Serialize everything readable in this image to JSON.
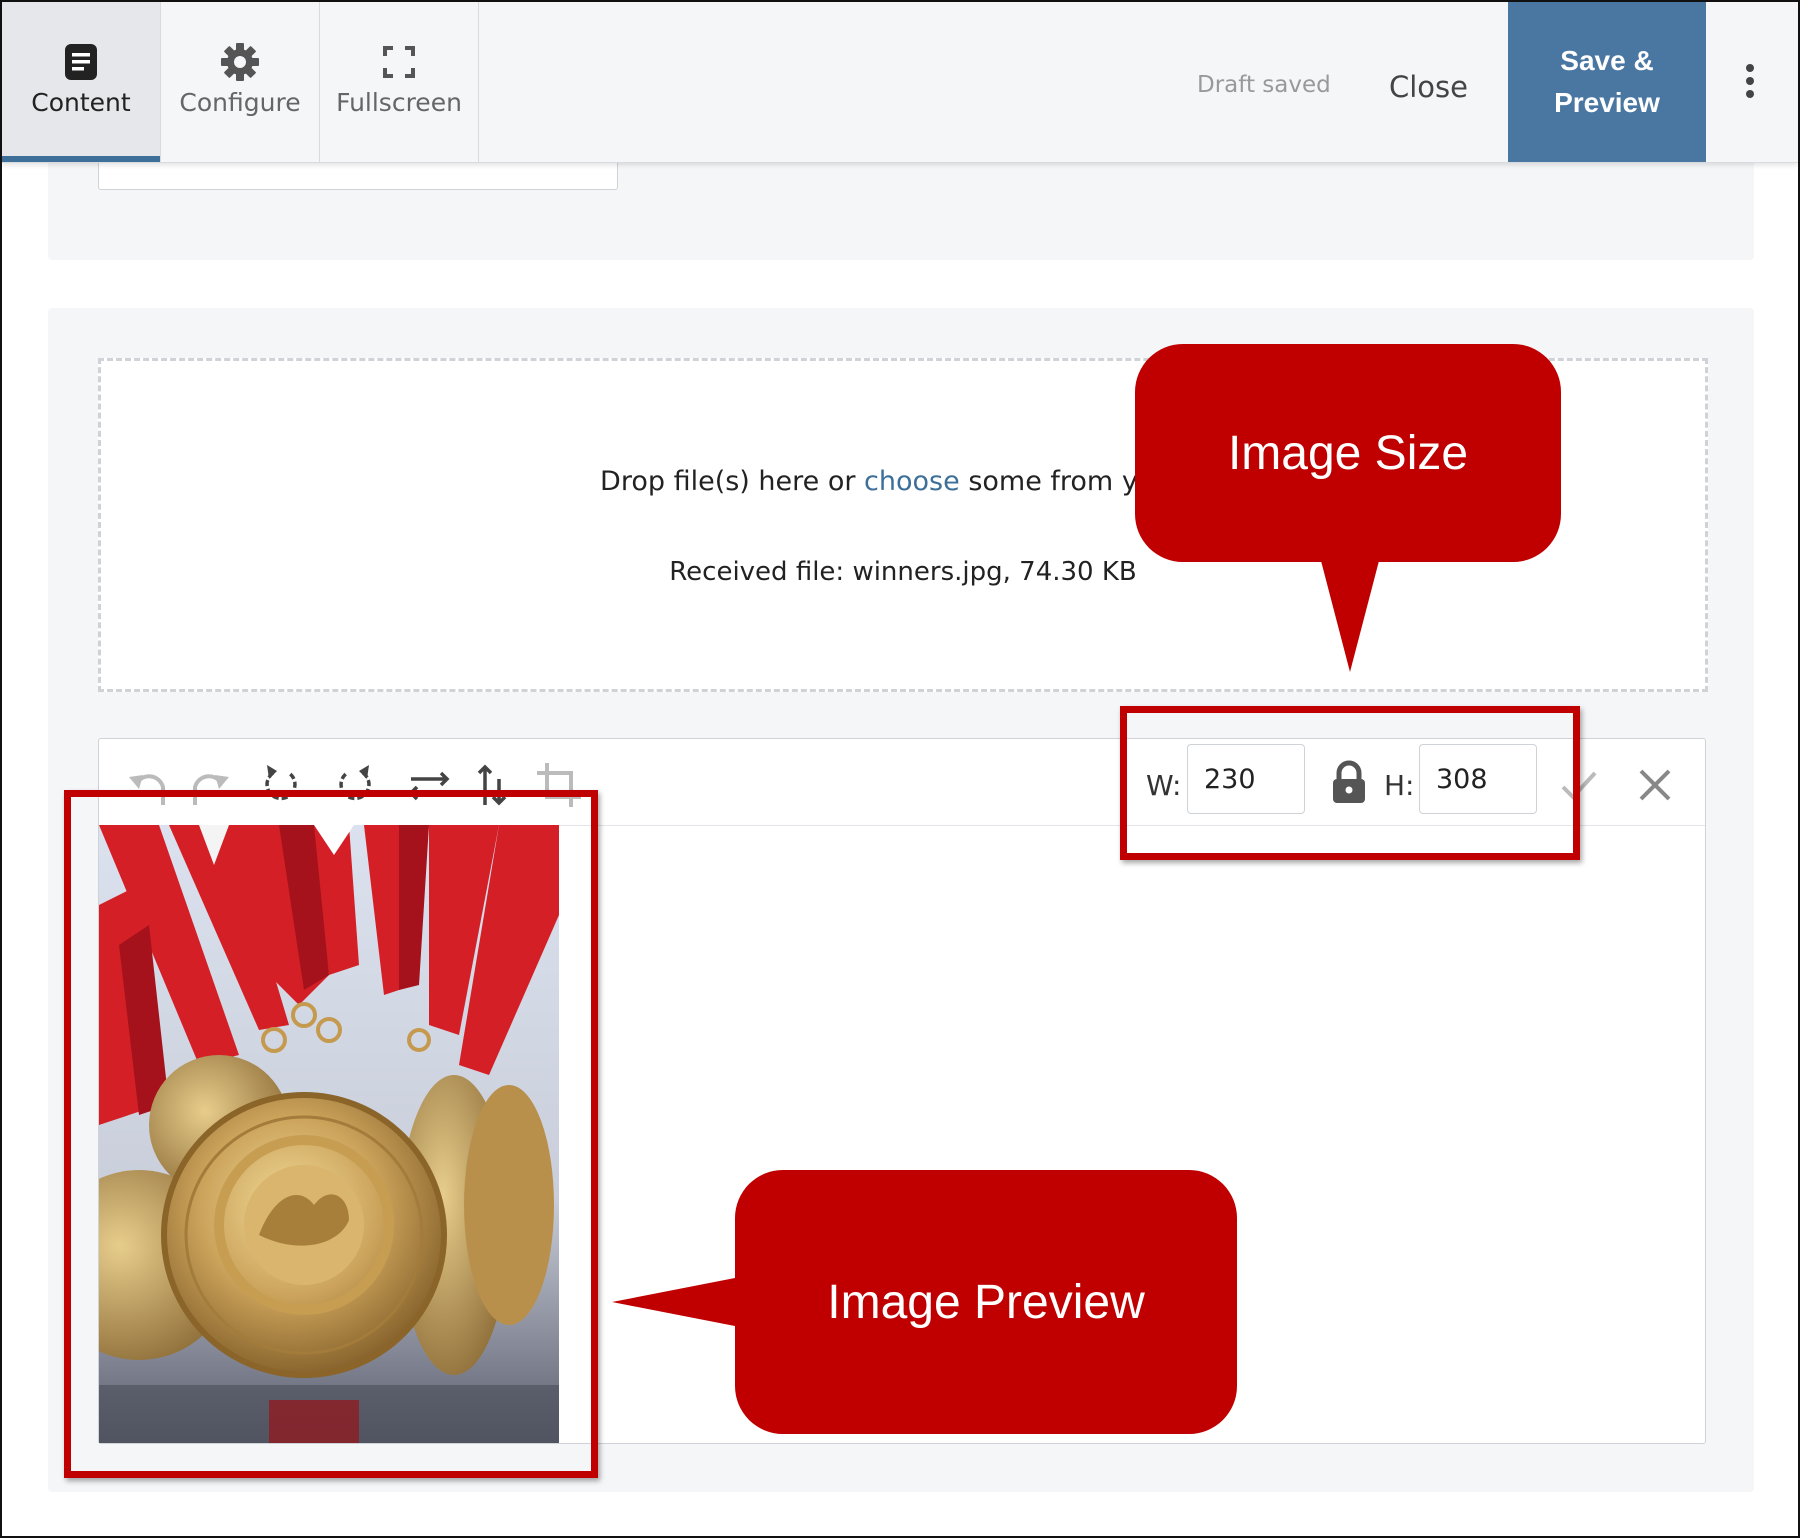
{
  "topbar": {
    "tabs": [
      {
        "label": "Content",
        "icon": "document-icon",
        "active": true
      },
      {
        "label": "Configure",
        "icon": "gear-icon",
        "active": false
      },
      {
        "label": "Fullscreen",
        "icon": "fullscreen-icon",
        "active": false
      }
    ],
    "draft_status": "Draft saved",
    "close_label": "Close",
    "save_label": "Save & Preview",
    "more_icon": "kebab-menu-icon"
  },
  "upload": {
    "prompt_before": "Drop file(s) here or ",
    "prompt_link": "choose",
    "prompt_after": " some from your c",
    "received": "Received file: winners.jpg, 74.30 KB"
  },
  "editor": {
    "tools": [
      "undo-icon",
      "redo-icon",
      "rotate-left-icon",
      "rotate-right-icon",
      "flip-horizontal-icon",
      "flip-vertical-icon",
      "crop-icon"
    ],
    "width_label": "W:",
    "width_value": "230",
    "lock_icon": "lock-icon",
    "height_label": "H:",
    "height_value": "308",
    "apply_icon": "checkmark-icon",
    "cancel_icon": "close-icon",
    "preview_image": "medals-photo"
  },
  "annotations": {
    "size_callout": "Image Size",
    "preview_callout": "Image Preview"
  },
  "colors": {
    "accent": "#4a77a2",
    "link": "#3e6f99",
    "annotation": "#c00000",
    "panel": "#f5f6f8"
  }
}
